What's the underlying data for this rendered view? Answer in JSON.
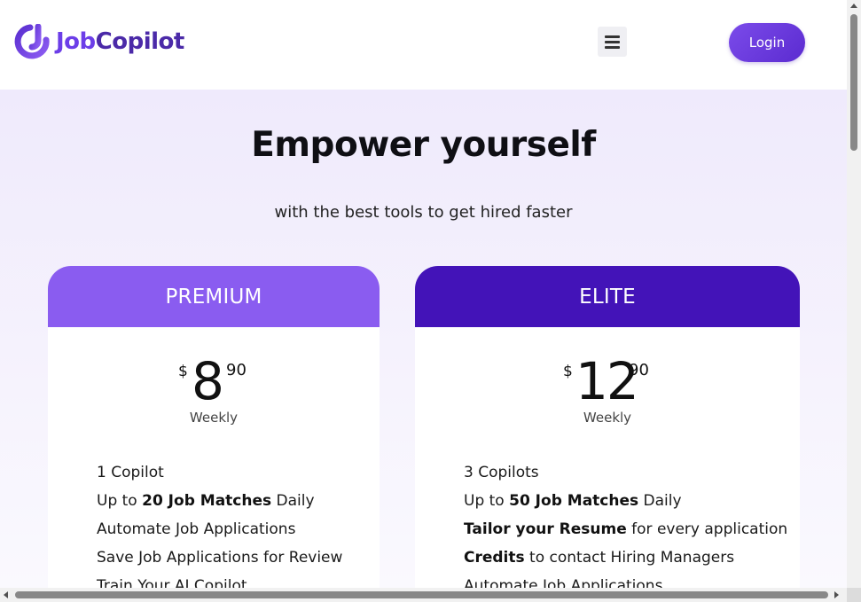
{
  "header": {
    "logo_job": "Job",
    "logo_copilot": "Copilot",
    "menu_icon": "hamburger-menu-icon",
    "login_label": "Login"
  },
  "hero": {
    "title": "Empower yourself",
    "subtitle": "with the best tools to get hired faster"
  },
  "plans": [
    {
      "name": "PREMIUM",
      "currency": "$",
      "amount": "8",
      "cents": "90",
      "period": "Weekly",
      "header_color": "#8a5cf0",
      "features": [
        {
          "pre": "1 Copilot",
          "bold": "",
          "post": ""
        },
        {
          "pre": "Up to ",
          "bold": "20 Job Matches",
          "post": " Daily"
        },
        {
          "pre": "Automate Job Applications",
          "bold": "",
          "post": ""
        },
        {
          "pre": "Save Job Applications for Review",
          "bold": "",
          "post": ""
        },
        {
          "pre": "Train Your AI Copilot",
          "bold": "",
          "post": ""
        }
      ]
    },
    {
      "name": "ELITE",
      "currency": "$",
      "amount": "12",
      "cents": "90",
      "period": "Weekly",
      "header_color": "#4313b8",
      "features": [
        {
          "pre": "3 Copilots",
          "bold": "",
          "post": ""
        },
        {
          "pre": "Up to ",
          "bold": "50 Job Matches",
          "post": " Daily"
        },
        {
          "pre": "",
          "bold": "Tailor your Resume",
          "post": " for every application"
        },
        {
          "pre": "",
          "bold": "Credits",
          "post": " to contact Hiring Managers"
        },
        {
          "pre": "Automate Job Applications",
          "bold": "",
          "post": ""
        }
      ]
    }
  ],
  "colors": {
    "brand_primary": "#6c3ee8",
    "brand_dark": "#4b2aa8",
    "page_background": "#efeafc"
  }
}
